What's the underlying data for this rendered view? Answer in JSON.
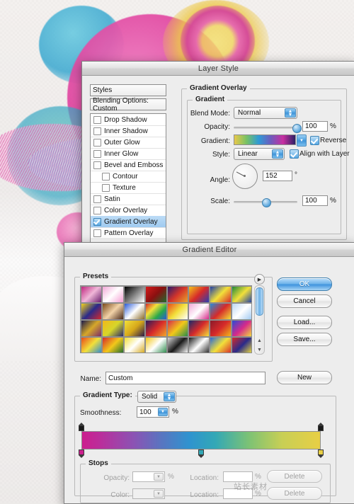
{
  "background": {
    "watermark": "站长素材"
  },
  "layer_style": {
    "title": "Layer Style",
    "styles_header": "Styles",
    "blending_options": "Blending Options: Custom",
    "effects": [
      {
        "label": "Drop Shadow",
        "checked": false,
        "indent": 0
      },
      {
        "label": "Inner Shadow",
        "checked": false,
        "indent": 0
      },
      {
        "label": "Outer Glow",
        "checked": false,
        "indent": 0
      },
      {
        "label": "Inner Glow",
        "checked": false,
        "indent": 0
      },
      {
        "label": "Bevel and Emboss",
        "checked": false,
        "indent": 0
      },
      {
        "label": "Contour",
        "checked": false,
        "indent": 1
      },
      {
        "label": "Texture",
        "checked": false,
        "indent": 1
      },
      {
        "label": "Satin",
        "checked": false,
        "indent": 0
      },
      {
        "label": "Color Overlay",
        "checked": false,
        "indent": 0
      },
      {
        "label": "Gradient Overlay",
        "checked": true,
        "indent": 0,
        "selected": true
      },
      {
        "label": "Pattern Overlay",
        "checked": false,
        "indent": 0
      }
    ],
    "section_title": "Gradient Overlay",
    "gradient_group": "Gradient",
    "blend_mode_label": "Blend Mode:",
    "blend_mode_value": "Normal",
    "opacity_label": "Opacity:",
    "opacity_value": "100",
    "opacity_unit": "%",
    "gradient_label": "Gradient:",
    "reverse_label": "Reverse",
    "reverse_checked": true,
    "style_label": "Style:",
    "style_value": "Linear",
    "align_label": "Align with Layer",
    "align_checked": true,
    "angle_label": "Angle:",
    "angle_value": "152",
    "angle_unit": "°",
    "scale_label": "Scale:",
    "scale_value": "100",
    "scale_unit": "%",
    "preview_gradient": "linear-gradient(to right,#e8c84a,#78c264,#2f9ad6,#6e5bbd,#c72fa0,#2b1f63)"
  },
  "gradient_editor": {
    "title": "Gradient Editor",
    "presets_label": "Presets",
    "buttons": {
      "ok": "OK",
      "cancel": "Cancel",
      "load": "Load...",
      "save": "Save..."
    },
    "name_label": "Name:",
    "name_value": "Custom",
    "new_button": "New",
    "gradient_type_label": "Gradient Type:",
    "gradient_type_value": "Solid",
    "smoothness_label": "Smoothness:",
    "smoothness_value": "100",
    "smoothness_unit": "%",
    "gradient_bar": "linear-gradient(to right,#cc1f8e 0%,#b92f9c 8%,#8a54b4 22%,#5a74c0 33%,#2f93cf 45%,#33a8b6 56%,#7cc275 70%,#c8cf55 84%,#e8cf45 100%)",
    "opacity_stops": [
      {
        "location": 0,
        "opacity": 100
      },
      {
        "location": 100,
        "opacity": 100
      }
    ],
    "color_stops": [
      {
        "location": 0,
        "color": "#cc1f8e"
      },
      {
        "location": 50,
        "color": "#33a8b6"
      },
      {
        "location": 100,
        "color": "#e8cf45"
      }
    ],
    "stops_label": "Stops",
    "stop_opacity_label": "Opacity:",
    "stop_opacity_value": "",
    "stop_opacity_unit": "%",
    "stop_opacity_location_label": "Location:",
    "stop_opacity_location_value": "",
    "stop_opacity_location_unit": "%",
    "stop_color_label": "Color:",
    "stop_color_location_label": "Location:",
    "stop_color_location_value": "",
    "stop_color_location_unit": "%",
    "delete_opacity_button": "Delete",
    "delete_color_button": "Delete",
    "presets": [
      [
        "#c0277f,#f0b7d8,#6a1f6e",
        "#f2a8d8,#ffffff,#f49ed2",
        "#000000,#ffffff",
        "#d61c1c,#8a1010,#1f6b2f",
        "#2a1a6b,#d4352a,#e8a52a",
        "#f2c21a,#d62a2a,#2a3fb0",
        "#1f3fa8,#f2e03a,#d62a2a",
        "#1f8a3a,#f2e03a,#1f3fa8"
      ],
      [
        "#f2d21a,#2a2a8a,#d62a2a",
        "#7a4a1a,#f2d2a8,#4a2a1a",
        "#2a5ad6,#ffffff,#8a6a2a",
        "#d62a2a,#f2e03a,#2aa84a,#2a5ad6",
        "#e84a1a,#f2e03a,#ffffff",
        "#f2a8d8,#ffffff,#d62a8a",
        "#2a8ad6,#d62a2a,#f2e03a",
        "#bcd8f2,#ffffff,#9ec8f2"
      ],
      [
        "#1a1a4a,#d6a82a,#7a2a6a",
        "#f2b81a,#d6d62a,#2a2a6a",
        "#f2e03a,#d6a81a,#2a1a4a",
        "#2a1a5a,#d62a2a,#f2a82a",
        "#d62a4a,#f2c81a,#2a8a4a",
        "#1a2a6a,#d62a2a,#f2e03a",
        "#8a1a2a,#d62a2a,#f2b81a",
        "#2a4ad6,#d62a8a,#f2e03a"
      ],
      [
        "#e84a1a,#f2e03a,#2a8ad6",
        "#d62a2a,#f2c81a,#1f6b2f",
        "#f2e03a,#ffffff,#d6a81a",
        "#f2c81a,#ffffff,#2a8a4a",
        "#d6d6d6,#1a1a1a,#ffffff",
        "#1a1a1a,#ffffff,#2a2a2a",
        "#2a6ad6,#f2e03a,#d62a2a",
        "#d62a2a,#2a2a8a,#f2e03a"
      ]
    ]
  }
}
